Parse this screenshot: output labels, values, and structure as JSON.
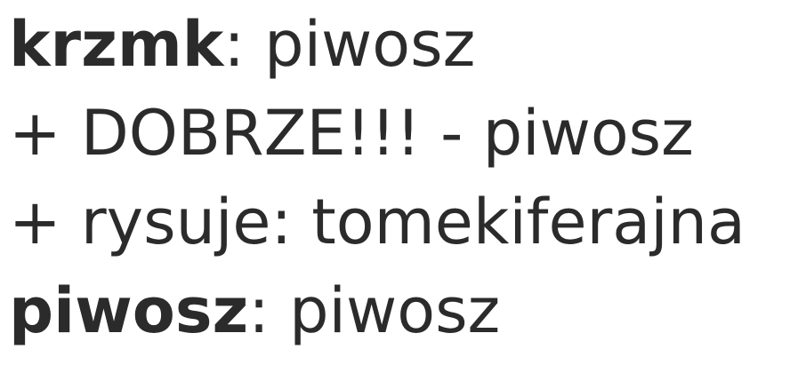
{
  "log": [
    {
      "user": "krzmk",
      "sep": ": ",
      "text": "piwosz"
    },
    {
      "text": "+ DOBRZE!!! - piwosz"
    },
    {
      "text": "+ rysuje: tomekiferajna"
    },
    {
      "user": "piwosz",
      "sep": ": ",
      "text": "piwosz"
    }
  ]
}
